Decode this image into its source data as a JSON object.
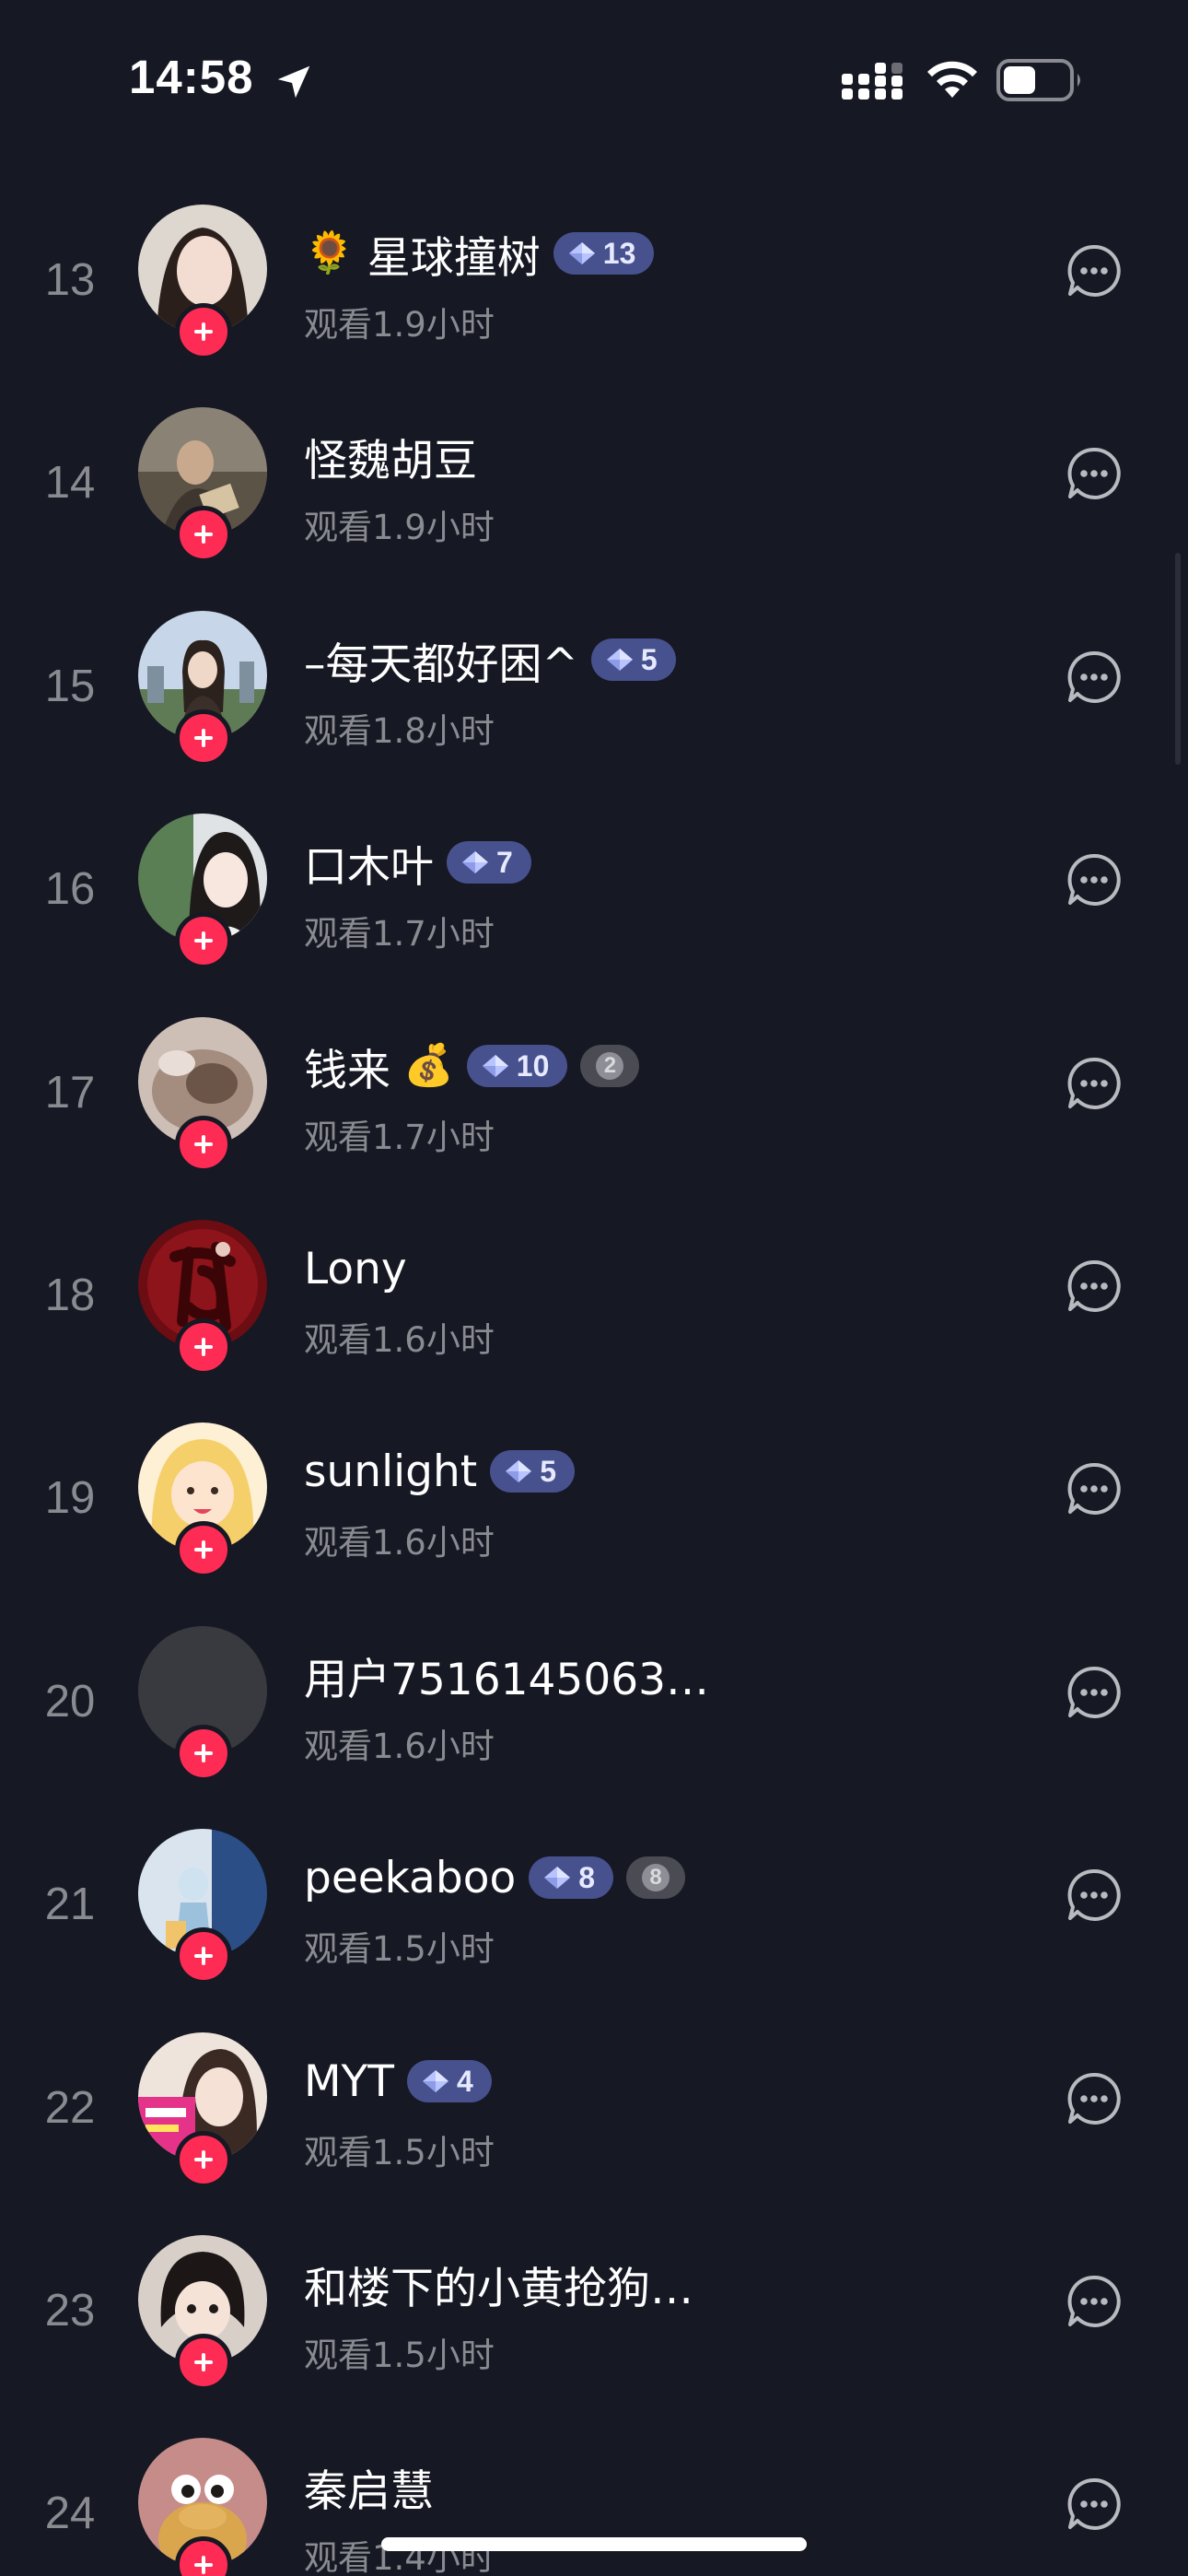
{
  "status_bar": {
    "time": "14:58",
    "icons": [
      "location-arrow-icon",
      "cellular-signal-icon",
      "wifi-icon",
      "battery-icon"
    ]
  },
  "colors": {
    "background": "#161823",
    "follow_button": "#fe2c55",
    "fan_badge": "#47518e",
    "secondary_text": "#8a8b91"
  },
  "viewers": [
    {
      "rank": "13",
      "name": "星球撞树",
      "emoji_before": "🌻",
      "emoji_after": "",
      "badge": "13",
      "extra_badge": "",
      "watch": "观看1.9小时"
    },
    {
      "rank": "14",
      "name": "怪魏胡豆",
      "emoji_before": "",
      "emoji_after": "",
      "badge": "",
      "extra_badge": "",
      "watch": "观看1.9小时"
    },
    {
      "rank": "15",
      "name": "–每天都好困^",
      "emoji_before": "",
      "emoji_after": "",
      "badge": "5",
      "extra_badge": "",
      "watch": "观看1.8小时"
    },
    {
      "rank": "16",
      "name": "口木叶",
      "emoji_before": "",
      "emoji_after": "",
      "badge": "7",
      "extra_badge": "",
      "watch": "观看1.7小时"
    },
    {
      "rank": "17",
      "name": "钱来",
      "emoji_before": "",
      "emoji_after": "💰",
      "badge": "10",
      "extra_badge": "2",
      "watch": "观看1.7小时"
    },
    {
      "rank": "18",
      "name": "Lony",
      "emoji_before": "",
      "emoji_after": "",
      "badge": "",
      "extra_badge": "",
      "watch": "观看1.6小时"
    },
    {
      "rank": "19",
      "name": "sunlight",
      "emoji_before": "",
      "emoji_after": "",
      "badge": "5",
      "extra_badge": "",
      "watch": "观看1.6小时"
    },
    {
      "rank": "20",
      "name": "用户7516145063…",
      "emoji_before": "",
      "emoji_after": "",
      "badge": "",
      "extra_badge": "",
      "watch": "观看1.6小时"
    },
    {
      "rank": "21",
      "name": "peekaboo",
      "emoji_before": "",
      "emoji_after": "",
      "badge": "8",
      "extra_badge": "8",
      "watch": "观看1.5小时"
    },
    {
      "rank": "22",
      "name": "MYT",
      "emoji_before": "",
      "emoji_after": "",
      "badge": "4",
      "extra_badge": "",
      "watch": "观看1.5小时"
    },
    {
      "rank": "23",
      "name": "和楼下的小黄抢狗…",
      "emoji_before": "",
      "emoji_after": "",
      "badge": "",
      "extra_badge": "",
      "watch": "观看1.5小时"
    },
    {
      "rank": "24",
      "name": "秦启慧",
      "emoji_before": "",
      "emoji_after": "",
      "badge": "",
      "extra_badge": "",
      "watch": "观看1.4小时"
    }
  ]
}
